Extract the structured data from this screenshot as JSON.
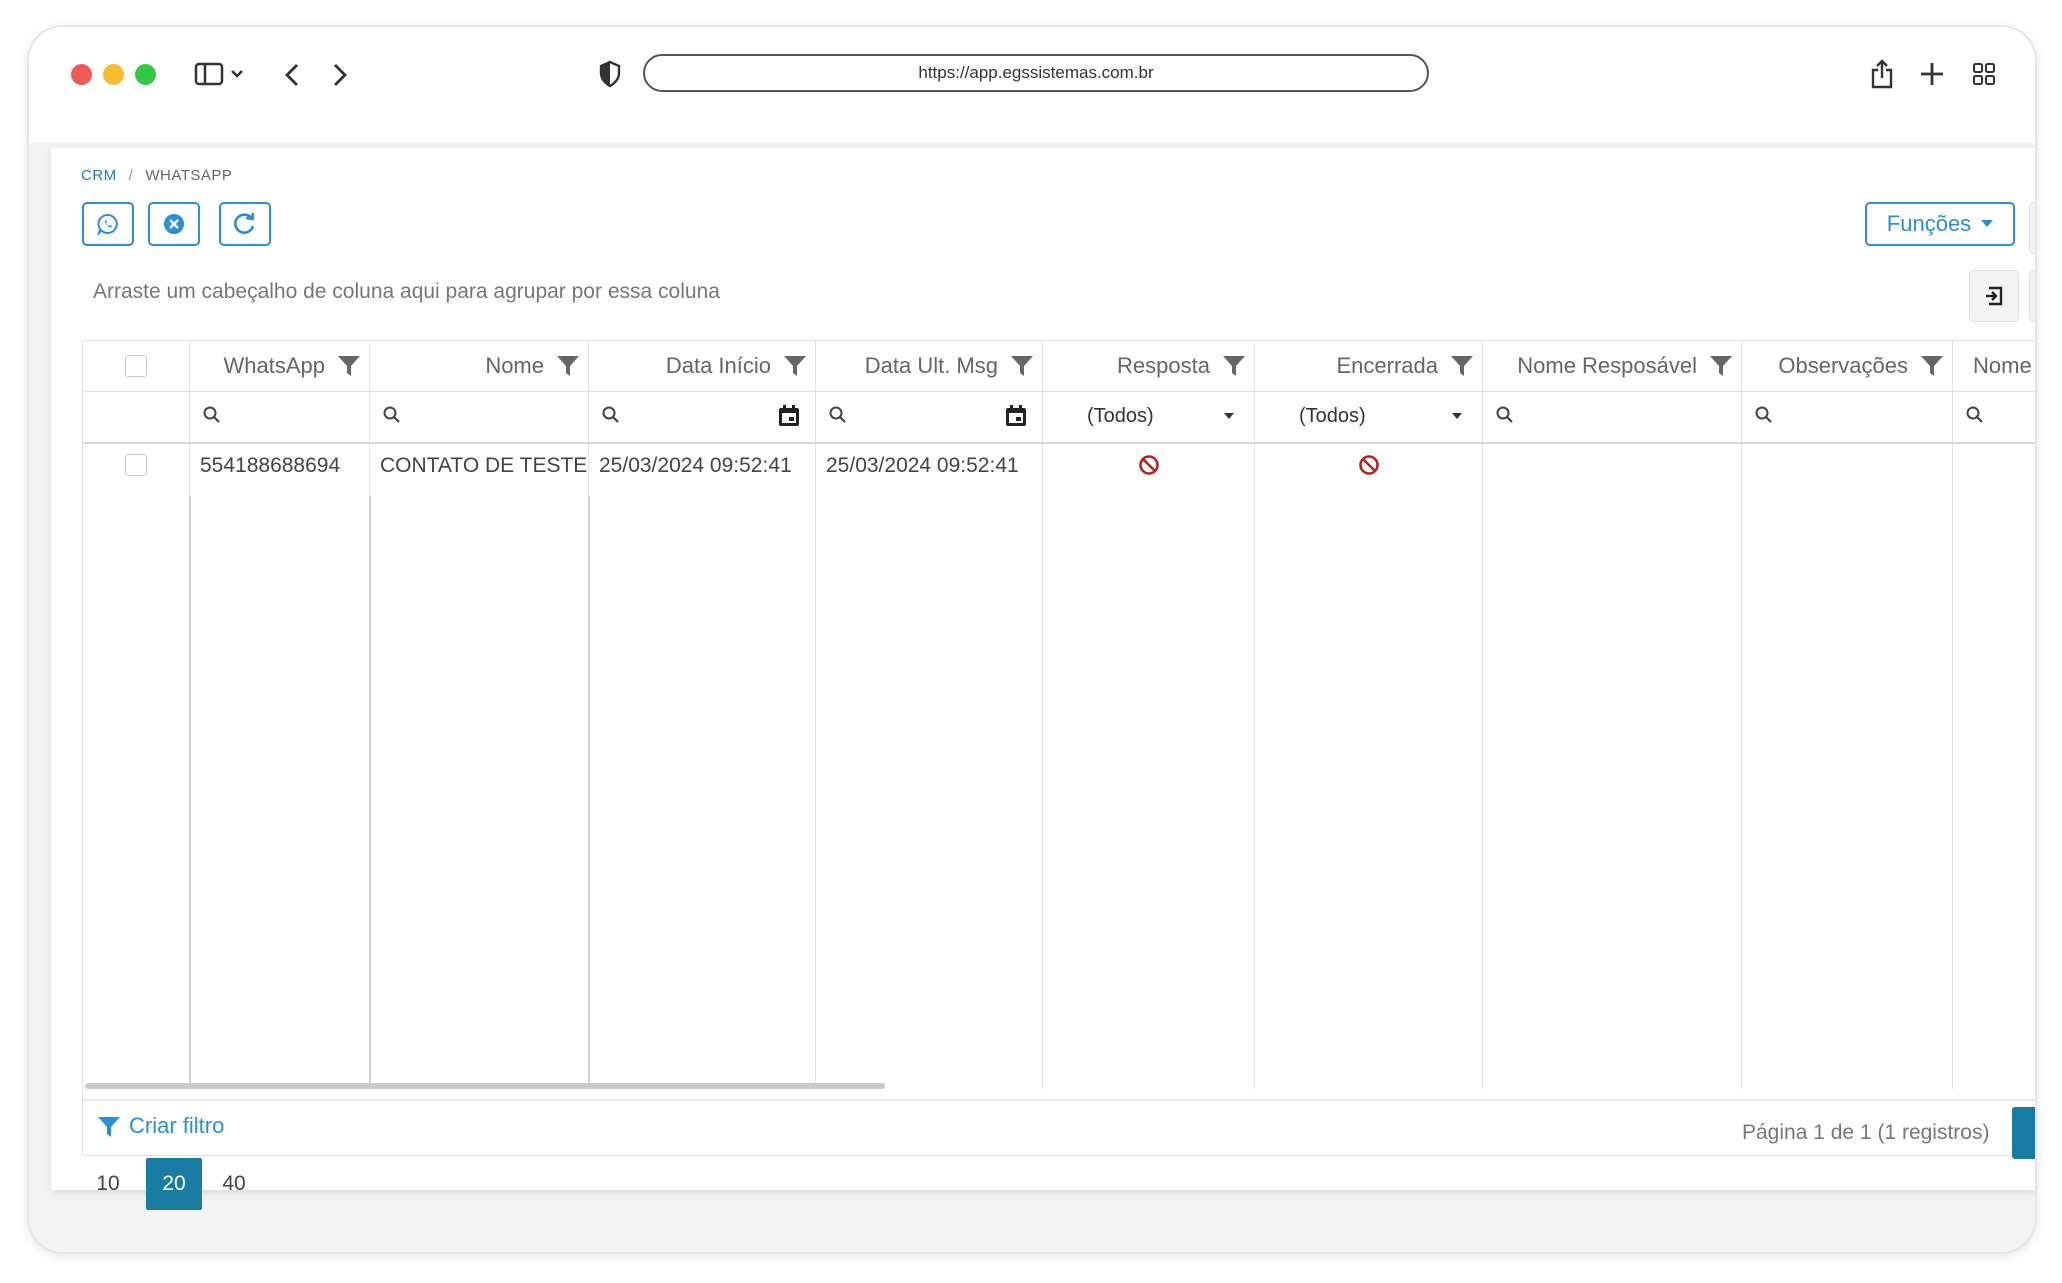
{
  "browser": {
    "url": "https://app.egssistemas.com.br"
  },
  "breadcrumb": {
    "root": "CRM",
    "separator": "/",
    "current": "WHATSAPP"
  },
  "toolbar": {
    "functions_label": "Funções"
  },
  "grid": {
    "group_panel_hint": "Arraste um cabeçalho de coluna aqui para agrupar por essa coluna",
    "columns": [
      "WhatsApp",
      "Nome",
      "Data Início",
      "Data Ult. Msg",
      "Resposta",
      "Encerrada",
      "Nome Resposável",
      "Observações",
      "Nome"
    ],
    "filter_all": "(Todos)",
    "rows": [
      {
        "whatsapp": "554188688694",
        "nome": "CONTATO DE TESTE",
        "data_inicio": "25/03/2024 09:52:41",
        "data_ult_msg": "25/03/2024 09:52:41",
        "resposta": "no",
        "encerrada": "no"
      }
    ],
    "create_filter_label": "Criar filtro"
  },
  "pager": {
    "sizes": [
      "10",
      "20",
      "40"
    ],
    "selected_size": "20",
    "info": "Página 1 de 1 (1 registros)"
  },
  "colors": {
    "accent": "#2a8fd6",
    "pager_active": "#187ca3",
    "no_icon": "#b3261e"
  }
}
